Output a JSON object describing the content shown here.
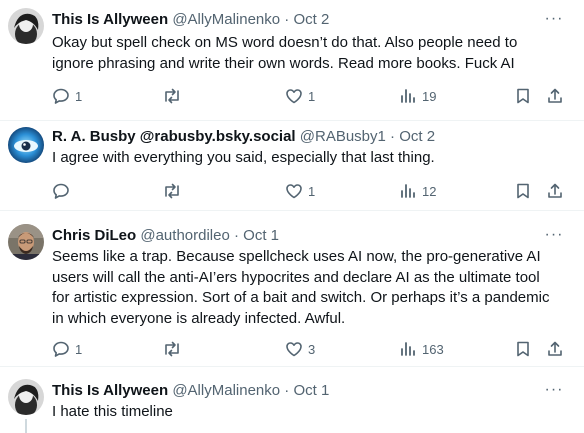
{
  "tweets": [
    {
      "name": "This Is Allyween",
      "handle": "@AllyMalinenko",
      "dot": "·",
      "date": "Oct 2",
      "more": "···",
      "lines": [
        "Okay but spell check on MS word doesn’t do that. Also people need to",
        "ignore phrasing and write their own words. Read more books. Fuck AI"
      ],
      "replies": "1",
      "retweets": "",
      "likes": "1",
      "views": "19"
    },
    {
      "name": "R. A. Busby @rabusby.bsky.social",
      "handle": "@RABusby1",
      "dot": "·",
      "date": "Oct 2",
      "more": "···",
      "lines": [
        "I agree with everything you said, especially that last thing."
      ],
      "replies": "",
      "retweets": "",
      "likes": "1",
      "views": "12"
    },
    {
      "name": "Chris DiLeo",
      "handle": "@authordileo",
      "dot": "·",
      "date": "Oct 1",
      "more": "···",
      "lines": [
        "Seems like a trap. Because spellcheck uses AI now, the pro-generative AI",
        "users will call the anti-AI’ers hypocrites and declare AI as the ultimate tool",
        "for artistic expression. Sort of a bait and switch. Or perhaps it’s a pandemic",
        "in which everyone is already infected. Awful."
      ],
      "replies": "1",
      "retweets": "",
      "likes": "3",
      "views": "163"
    },
    {
      "name": "This Is Allyween",
      "handle": "@AllyMalinenko",
      "dot": "·",
      "date": "Oct 1",
      "more": "···",
      "lines": [
        "I hate this timeline"
      ]
    }
  ],
  "colors": {
    "text": "#0f1419",
    "muted": "#536471",
    "separator": "#eff3f4",
    "thread_line": "#cfd9de"
  },
  "icons": [
    "reply-icon",
    "retweet-icon",
    "like-icon",
    "views-icon",
    "bookmark-icon",
    "share-icon",
    "more-icon"
  ]
}
